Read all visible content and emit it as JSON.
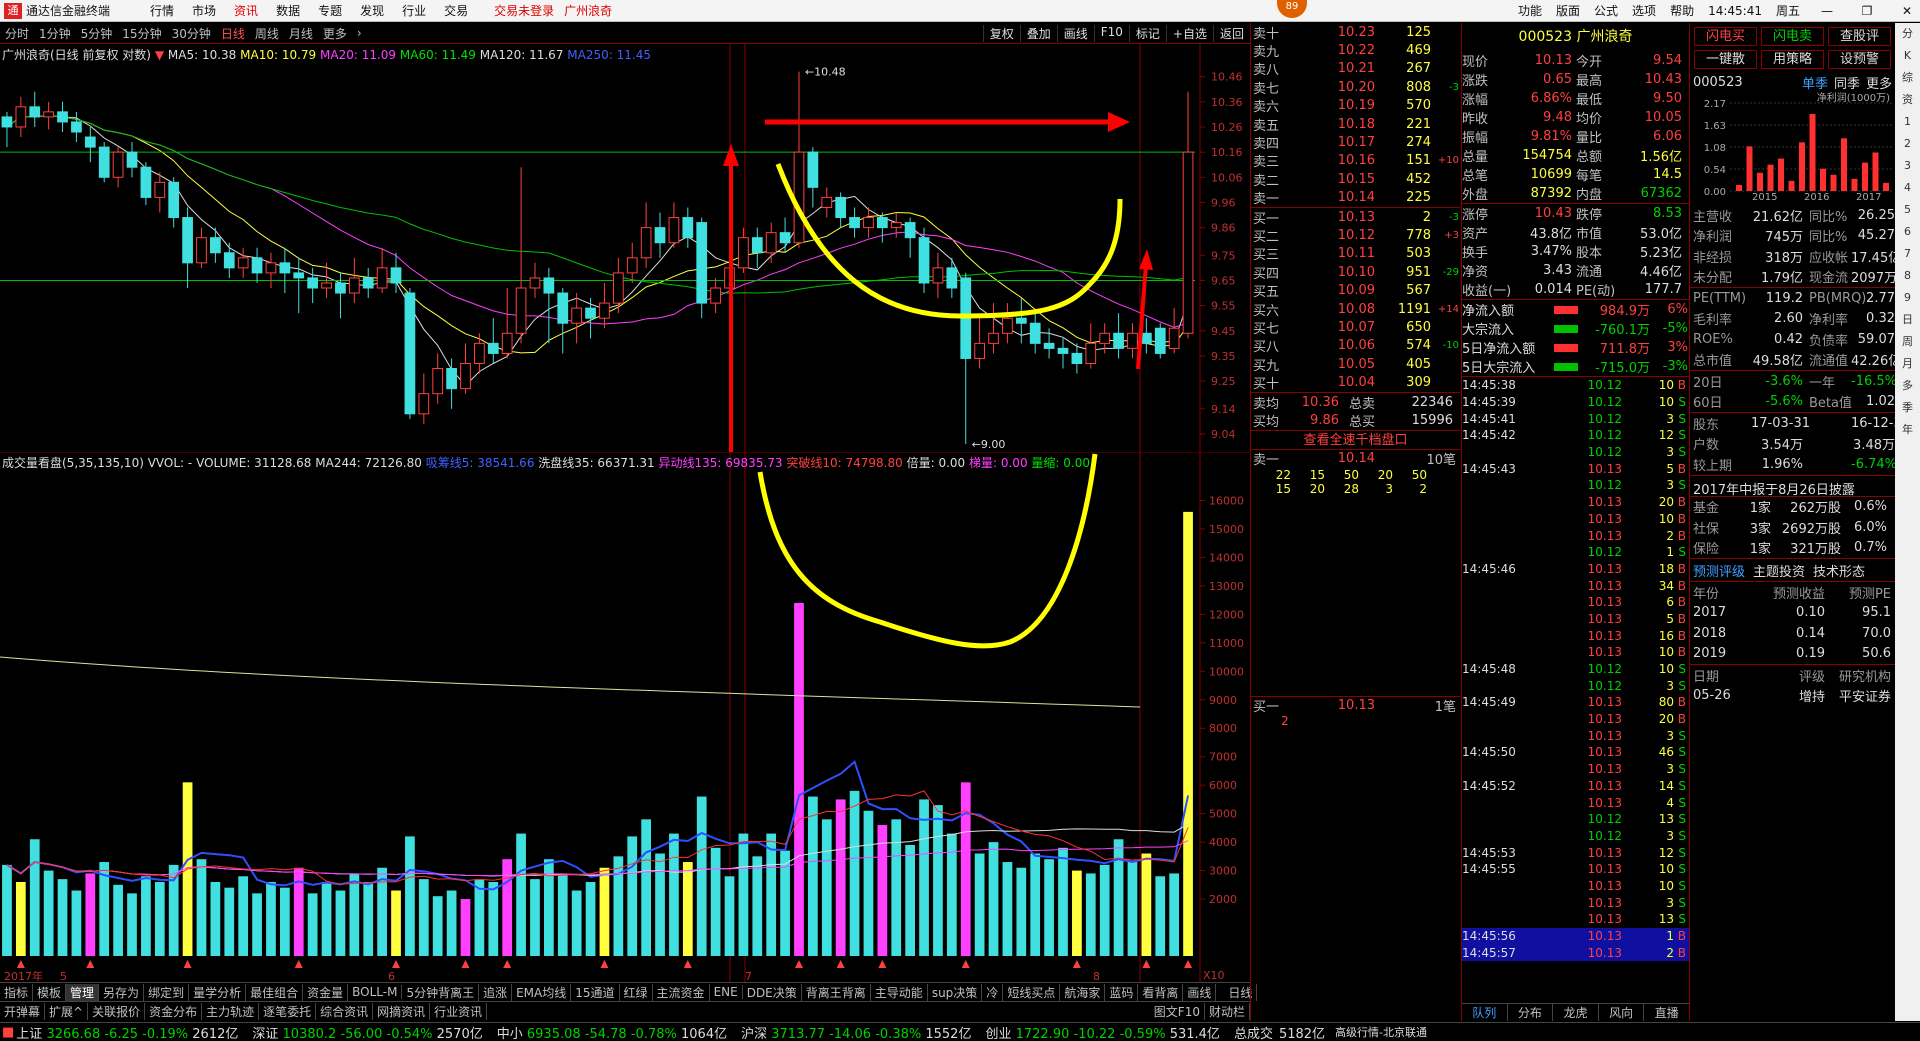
{
  "titlebar": {
    "app": "通达信金融终端",
    "menu": [
      "行情",
      "市场",
      "资讯",
      "数据",
      "专题",
      "发现",
      "行业",
      "交易"
    ],
    "active": "资讯",
    "warn": "交易未登录",
    "stock": "广州浪奇",
    "right": [
      "功能",
      "版面",
      "公式",
      "选项",
      "帮助"
    ],
    "clock": "14:45:41",
    "weekday": "周五",
    "badge": "89"
  },
  "periods": [
    "分时",
    "1分钟",
    "5分钟",
    "15分钟",
    "30分钟",
    "日线",
    "周线",
    "月线",
    "更多"
  ],
  "active_period": "日线",
  "tools": [
    "复权",
    "叠加",
    "画线",
    "F10",
    "标记",
    "+自选",
    "返回"
  ],
  "legend": {
    "name": "广州浪奇(日线 前复权 对数)",
    "ma5": "MA5: 10.38",
    "ma10": "MA10: 10.79",
    "ma20": "MA20: 11.09",
    "ma60": "MA60: 11.49",
    "ma120": "MA120: 11.67",
    "ma250": "MA250: 11.45"
  },
  "vol_legend": {
    "name": "成交量看盘(5,35,135,10)",
    "vvol": "VVOL: -",
    "volume": "VOLUME: 31128.68",
    "ma244": "MA244: 72126.80",
    "l1": "吸筹线5: 38541.66",
    "l2": "洗盘线35: 66371.31",
    "l3": "异动线135: 69835.73",
    "l4": "突破线10: 74798.80",
    "l5": "倍量: 0.00",
    "l6": "梯量: 0.00",
    "l7": "量缩: 0.00"
  },
  "chart_data": {
    "type": "candlestick",
    "price_axis": [
      10.46,
      10.36,
      10.26,
      10.16,
      10.06,
      9.96,
      9.86,
      9.75,
      9.65,
      9.55,
      9.45,
      9.35,
      9.25,
      9.14,
      9.04
    ],
    "ylim": [
      9.0,
      10.55
    ],
    "high_label": "10.48",
    "low_label": "9.00",
    "month_labels": [
      "2017年",
      "5",
      "6",
      "7",
      "8"
    ],
    "vol_axis": [
      16000,
      15000,
      14000,
      13000,
      12000,
      11000,
      10000,
      9000,
      8000,
      7000,
      6000,
      5000,
      4000,
      3000,
      2000
    ],
    "vol_ylim": [
      0,
      17000
    ],
    "candles": [
      [
        10.3,
        10.26,
        10.32,
        10.18
      ],
      [
        10.26,
        10.34,
        10.38,
        10.22
      ],
      [
        10.34,
        10.3,
        10.4,
        10.26
      ],
      [
        10.3,
        10.32,
        10.36,
        10.25
      ],
      [
        10.32,
        10.28,
        10.36,
        10.24
      ],
      [
        10.28,
        10.24,
        10.32,
        10.2
      ],
      [
        10.22,
        10.18,
        10.26,
        10.12
      ],
      [
        10.18,
        10.06,
        10.2,
        10.04
      ],
      [
        10.06,
        10.16,
        10.18,
        10.02
      ],
      [
        10.16,
        10.1,
        10.2,
        10.06
      ],
      [
        10.1,
        9.98,
        10.12,
        9.95
      ],
      [
        9.98,
        10.04,
        10.08,
        9.92
      ],
      [
        10.04,
        9.9,
        10.06,
        9.86
      ],
      [
        9.9,
        9.72,
        9.94,
        9.62
      ],
      [
        9.72,
        9.82,
        9.86,
        9.7
      ],
      [
        9.82,
        9.76,
        9.86,
        9.72
      ],
      [
        9.76,
        9.7,
        9.8,
        9.66
      ],
      [
        9.7,
        9.74,
        9.78,
        9.66
      ],
      [
        9.74,
        9.68,
        9.78,
        9.64
      ],
      [
        9.68,
        9.72,
        9.76,
        9.62
      ],
      [
        9.72,
        9.68,
        9.78,
        9.6
      ],
      [
        9.68,
        9.66,
        9.74,
        9.52
      ],
      [
        9.66,
        9.62,
        9.7,
        9.56
      ],
      [
        9.62,
        9.64,
        9.72,
        9.58
      ],
      [
        9.64,
        9.6,
        9.68,
        9.5
      ],
      [
        9.6,
        9.66,
        9.74,
        9.56
      ],
      [
        9.66,
        9.62,
        9.7,
        9.58
      ],
      [
        9.62,
        9.7,
        9.78,
        9.6
      ],
      [
        9.7,
        9.64,
        9.76,
        9.6
      ],
      [
        9.6,
        9.12,
        9.62,
        9.1
      ],
      [
        9.12,
        9.2,
        9.28,
        9.08
      ],
      [
        9.2,
        9.3,
        9.36,
        9.16
      ],
      [
        9.3,
        9.22,
        9.34,
        9.14
      ],
      [
        9.22,
        9.32,
        9.4,
        9.2
      ],
      [
        9.32,
        9.4,
        9.44,
        9.28
      ],
      [
        9.4,
        9.36,
        9.5,
        9.32
      ],
      [
        9.36,
        9.44,
        9.62,
        9.34
      ],
      [
        9.44,
        9.62,
        10.1,
        9.4
      ],
      [
        9.62,
        9.66,
        9.72,
        9.58
      ],
      [
        9.66,
        9.6,
        9.7,
        9.4
      ],
      [
        9.6,
        9.48,
        9.62,
        9.36
      ],
      [
        9.48,
        9.54,
        9.6,
        9.4
      ],
      [
        9.54,
        9.5,
        9.58,
        9.42
      ],
      [
        9.5,
        9.56,
        9.64,
        9.46
      ],
      [
        9.56,
        9.68,
        9.74,
        9.52
      ],
      [
        9.68,
        9.74,
        9.8,
        9.64
      ],
      [
        9.74,
        9.86,
        9.96,
        9.7
      ],
      [
        9.86,
        9.8,
        9.92,
        9.74
      ],
      [
        9.8,
        9.9,
        9.96,
        9.78
      ],
      [
        9.9,
        9.82,
        9.94,
        9.78
      ],
      [
        9.88,
        9.56,
        9.9,
        9.5
      ],
      [
        9.56,
        9.62,
        9.66,
        9.52
      ],
      [
        9.62,
        9.7,
        9.8,
        9.58
      ],
      [
        9.7,
        9.82,
        9.86,
        9.68
      ],
      [
        9.82,
        9.76,
        9.86,
        9.7
      ],
      [
        9.76,
        9.84,
        9.88,
        9.72
      ],
      [
        9.84,
        9.8,
        9.9,
        9.76
      ],
      [
        9.8,
        10.16,
        10.48,
        9.78
      ],
      [
        10.16,
        10.02,
        10.18,
        9.94
      ],
      [
        9.94,
        9.98,
        10.02,
        9.9
      ],
      [
        9.98,
        9.9,
        10.0,
        9.86
      ],
      [
        9.9,
        9.86,
        9.94,
        9.82
      ],
      [
        9.86,
        9.9,
        9.94,
        9.82
      ],
      [
        9.9,
        9.86,
        9.92,
        9.8
      ],
      [
        9.86,
        9.88,
        9.92,
        9.82
      ],
      [
        9.88,
        9.82,
        9.9,
        9.74
      ],
      [
        9.82,
        9.64,
        9.86,
        9.6
      ],
      [
        9.64,
        9.7,
        9.76,
        9.58
      ],
      [
        9.7,
        9.62,
        9.74,
        9.58
      ],
      [
        9.66,
        9.34,
        9.68,
        9.0
      ],
      [
        9.34,
        9.4,
        9.5,
        9.3
      ],
      [
        9.4,
        9.44,
        9.56,
        9.36
      ],
      [
        9.44,
        9.5,
        9.56,
        9.4
      ],
      [
        9.5,
        9.48,
        9.58,
        9.4
      ],
      [
        9.48,
        9.4,
        9.52,
        9.36
      ],
      [
        9.4,
        9.38,
        9.46,
        9.34
      ],
      [
        9.38,
        9.36,
        9.42,
        9.3
      ],
      [
        9.36,
        9.32,
        9.4,
        9.28
      ],
      [
        9.32,
        9.4,
        9.48,
        9.3
      ],
      [
        9.4,
        9.44,
        9.48,
        9.36
      ],
      [
        9.44,
        9.38,
        9.52,
        9.34
      ],
      [
        9.38,
        9.44,
        9.48,
        9.34
      ],
      [
        9.44,
        9.4,
        9.5,
        9.36
      ],
      [
        9.46,
        9.36,
        9.48,
        9.34
      ],
      [
        9.38,
        9.46,
        9.54,
        9.36
      ],
      [
        9.44,
        10.16,
        10.4,
        9.42
      ]
    ],
    "volumes": [
      3200,
      2600,
      4100,
      3000,
      2700,
      2300,
      2900,
      3300,
      2500,
      2200,
      2800,
      2600,
      3200,
      6100,
      3400,
      2600,
      2400,
      2800,
      2200,
      2600,
      2400,
      3100,
      2200,
      2600,
      2300,
      2900,
      2600,
      3100,
      2300,
      4200,
      2700,
      2100,
      2300,
      2000,
      2700,
      2600,
      3400,
      4300,
      2700,
      3400,
      2900,
      2300,
      2600,
      3100,
      3500,
      4200,
      4800,
      3600,
      4300,
      3300,
      5600,
      3800,
      2800,
      4300,
      3500,
      4300,
      3700,
      12400,
      5600,
      4800,
      5500,
      5800,
      5100,
      4600,
      4800,
      3900,
      5500,
      5300,
      4300,
      6100,
      3600,
      4000,
      3300,
      3100,
      3600,
      3400,
      3800,
      3000,
      2900,
      3200,
      4100,
      3300,
      3600,
      2800,
      2900,
      15600
    ]
  },
  "orderbook": {
    "asks": [
      [
        "卖十",
        "10.23",
        "125",
        ""
      ],
      [
        "卖九",
        "10.22",
        "469",
        ""
      ],
      [
        "卖八",
        "10.21",
        "267",
        ""
      ],
      [
        "卖七",
        "10.20",
        "808",
        "-3"
      ],
      [
        "卖六",
        "10.19",
        "570",
        ""
      ],
      [
        "卖五",
        "10.18",
        "221",
        ""
      ],
      [
        "卖四",
        "10.17",
        "274",
        ""
      ],
      [
        "卖三",
        "10.16",
        "151",
        "+10"
      ],
      [
        "卖二",
        "10.15",
        "452",
        ""
      ],
      [
        "卖一",
        "10.14",
        "225",
        ""
      ]
    ],
    "bids": [
      [
        "买一",
        "10.13",
        "2",
        "-3"
      ],
      [
        "买二",
        "10.12",
        "778",
        "+3"
      ],
      [
        "买三",
        "10.11",
        "503",
        ""
      ],
      [
        "买四",
        "10.10",
        "951",
        "-29"
      ],
      [
        "买五",
        "10.09",
        "567",
        ""
      ],
      [
        "买六",
        "10.08",
        "1191",
        "+14"
      ],
      [
        "买七",
        "10.07",
        "650",
        ""
      ],
      [
        "买八",
        "10.06",
        "574",
        "-10"
      ],
      [
        "买九",
        "10.05",
        "405",
        ""
      ],
      [
        "买十",
        "10.04",
        "309",
        ""
      ]
    ],
    "avg": [
      [
        "卖均",
        "10.36",
        "总卖",
        "22346"
      ],
      [
        "买均",
        "9.86",
        "总买",
        "15996"
      ]
    ],
    "link": "查看全速千档盘口",
    "sell1": {
      "label": "卖一",
      "price": "10.14",
      "count": "10笔",
      "qty": [
        "22",
        "15",
        "50",
        "20",
        "50",
        "15",
        "20",
        "28",
        "3",
        "2"
      ]
    },
    "buy1": {
      "label": "买一",
      "price": "10.13",
      "count": "1笔",
      "qty": "2"
    }
  },
  "quote": {
    "code": "000523",
    "name": "广州浪奇",
    "rows": [
      [
        "现价",
        "10.13",
        "今开",
        "9.54"
      ],
      [
        "涨跌",
        "0.65",
        "最高",
        "10.43"
      ],
      [
        "涨幅",
        "6.86%",
        "最低",
        "9.50"
      ],
      [
        "昨收",
        "9.48",
        "均价",
        "10.05"
      ],
      [
        "振幅",
        "9.81%",
        "量比",
        "6.06"
      ],
      [
        "总量",
        "154754",
        "总额",
        "1.56亿"
      ],
      [
        "总笔",
        "10699",
        "每笔",
        "14.5"
      ],
      [
        "外盘",
        "87392",
        "内盘",
        "67362"
      ]
    ],
    "rows2": [
      [
        "涨停",
        "10.43",
        "跌停",
        "8.53"
      ],
      [
        "资产",
        "43.8亿",
        "市值",
        "53.0亿"
      ],
      [
        "换手",
        "3.47%",
        "股本",
        "5.23亿"
      ],
      [
        "净资",
        "3.43",
        "流通",
        "4.46亿"
      ],
      [
        "收益(一)",
        "0.014",
        "PE(动)",
        "177.7"
      ]
    ],
    "flows": [
      [
        "净流入额",
        "984.9万",
        "6%",
        "red"
      ],
      [
        "大宗流入",
        "-760.1万",
        "-5%",
        "green"
      ],
      [
        "5日净流入额",
        "711.8万",
        "3%",
        "red"
      ],
      [
        "5日大宗流入",
        "-715.0万",
        "-3%",
        "green"
      ]
    ],
    "ticks": [
      [
        "14:45:38",
        "10.12",
        "10",
        "B"
      ],
      [
        "14:45:39",
        "10.12",
        "10",
        "S"
      ],
      [
        "14:45:41",
        "10.12",
        "3",
        "S"
      ],
      [
        "14:45:42",
        "10.12",
        "12",
        "S"
      ],
      [
        "",
        "10.12",
        "3",
        "S"
      ],
      [
        "14:45:43",
        "10.13",
        "5",
        "B"
      ],
      [
        "",
        "10.12",
        "3",
        "S"
      ],
      [
        "",
        "10.13",
        "20",
        "B"
      ],
      [
        "",
        "10.13",
        "10",
        "B"
      ],
      [
        "",
        "10.13",
        "2",
        "B"
      ],
      [
        "",
        "10.12",
        "1",
        "S"
      ],
      [
        "14:45:46",
        "10.13",
        "18",
        "B"
      ],
      [
        "",
        "10.13",
        "34",
        "B"
      ],
      [
        "",
        "10.13",
        "6",
        "B"
      ],
      [
        "",
        "10.13",
        "5",
        "B"
      ],
      [
        "",
        "10.13",
        "16",
        "B"
      ],
      [
        "",
        "10.13",
        "10",
        "B"
      ],
      [
        "14:45:48",
        "10.12",
        "10",
        "S"
      ],
      [
        "",
        "10.12",
        "3",
        "S"
      ],
      [
        "14:45:49",
        "10.13",
        "80",
        "B"
      ],
      [
        "",
        "10.13",
        "20",
        "B"
      ],
      [
        "",
        "10.13",
        "3",
        "S"
      ],
      [
        "14:45:50",
        "10.13",
        "46",
        "S"
      ],
      [
        "",
        "10.13",
        "3",
        "S"
      ],
      [
        "14:45:52",
        "10.13",
        "14",
        "S"
      ],
      [
        "",
        "10.13",
        "4",
        "S"
      ],
      [
        "",
        "10.12",
        "13",
        "S"
      ],
      [
        "",
        "10.12",
        "3",
        "S"
      ],
      [
        "14:45:53",
        "10.13",
        "12",
        "S"
      ],
      [
        "14:45:55",
        "10.13",
        "10",
        "S"
      ],
      [
        "",
        "10.13",
        "10",
        "S"
      ],
      [
        "",
        "10.13",
        "3",
        "S"
      ],
      [
        "",
        "10.13",
        "13",
        "S"
      ],
      [
        "14:45:56",
        "10.13",
        "1",
        "B"
      ],
      [
        "14:45:57",
        "10.13",
        "2",
        "B"
      ]
    ],
    "tabs": [
      "队列",
      "分布",
      "龙虎",
      "风向",
      "直播"
    ]
  },
  "f10": {
    "buttons": [
      "闪电买",
      "闪电卖",
      "查股评",
      "一键散",
      "用策略",
      "设预警"
    ],
    "code": "000523",
    "tabs": [
      "单季",
      "同季",
      "更多"
    ],
    "chart_title": "净利润(1000万)",
    "years": [
      "2015",
      "2016",
      "2017"
    ],
    "yticks": [
      "2.17",
      "1.63",
      "1.08",
      "0.54",
      "0.00"
    ],
    "bars": [
      0.15,
      1.1,
      0.45,
      0.65,
      0.8,
      0.25,
      1.2,
      1.9,
      0.55,
      0.4,
      1.3,
      0.3,
      0.7,
      0.95,
      0.2
    ],
    "rows": [
      [
        "主营收",
        "21.62亿",
        "同比%",
        "26.25"
      ],
      [
        "净利润",
        "745万",
        "同比%",
        "45.27"
      ],
      [
        "非经损",
        "318万",
        "应收帐",
        "17.45亿"
      ],
      [
        "未分配",
        "1.79亿",
        "现金流",
        "2097万"
      ]
    ],
    "rows2": [
      [
        "PE(TTM)",
        "119.2",
        "PB(MRQ)",
        "2.77"
      ],
      [
        "毛利率",
        "2.60",
        "净利率",
        "0.32"
      ],
      [
        "ROE%",
        "0.42",
        "负债率",
        "59.07"
      ],
      [
        "总市值",
        "49.58亿",
        "流通值",
        "42.26亿"
      ]
    ],
    "rows3": [
      [
        "20日",
        "-3.6%",
        "一年",
        "-16.5%"
      ],
      [
        "60日",
        "-5.6%",
        "Beta值",
        "1.02"
      ]
    ],
    "rows4": [
      [
        "股东",
        "17-03-31",
        "",
        "16-12-31"
      ],
      [
        "户数",
        "3.54万",
        "",
        "3.48万"
      ],
      [
        "较上期",
        "1.96%",
        "",
        "-6.74%"
      ]
    ],
    "report": "2017年中报于8月26日披露",
    "holders": [
      [
        "基金",
        "1家",
        "262万股",
        "0.6%"
      ],
      [
        "社保",
        "3家",
        "2692万股",
        "6.0%"
      ],
      [
        "保险",
        "1家",
        "321万股",
        "0.7%"
      ]
    ],
    "subtabs": [
      "预测评级",
      "主题投资",
      "技术形态"
    ],
    "fc_head": [
      "年份",
      "预测收益",
      "预测PE"
    ],
    "forecast": [
      [
        "2017",
        "0.10",
        "95.1"
      ],
      [
        "2018",
        "0.14",
        "70.0"
      ],
      [
        "2019",
        "0.19",
        "50.6"
      ]
    ],
    "rating_head": [
      "日期",
      "评级",
      "研究机构"
    ],
    "rating": [
      "05-26",
      "增持",
      "平安证券"
    ]
  },
  "bottom": {
    "row1": [
      "指标",
      "模板",
      "管理",
      "另存为",
      "绑定到",
      "量学分析",
      "最佳组合",
      "资金量",
      "BOLL-M",
      "5分钟背离王",
      "追涨",
      "EMA均线",
      "15通道",
      "红绿",
      "主流资金",
      "ENE",
      "DDE决策",
      "背离王背离",
      "主导动能",
      "sup决策",
      "冷",
      "短线买点",
      "航海家",
      "蓝码",
      "看背离",
      "画线"
    ],
    "row2": [
      "开弹幕",
      "扩展^",
      "关联报价",
      "资金分布",
      "主力轨迹",
      "逐笔委托",
      "综合资讯",
      "网摘资讯",
      "行业资讯"
    ],
    "right1": "日线",
    "right2": [
      "图文F10",
      "财动栏"
    ]
  },
  "status": [
    [
      "上证",
      "3266.68",
      "-6.25",
      "-0.19%",
      "2612亿"
    ],
    [
      "深证",
      "10380.2",
      "-56.00",
      "-0.54%",
      "2570亿"
    ],
    [
      "中小",
      "6935.08",
      "-54.78",
      "-0.78%",
      "1064亿"
    ],
    [
      "沪深",
      "3713.77",
      "-14.06",
      "-0.38%",
      "1552亿"
    ],
    [
      "创业",
      "1722.90",
      "-10.22",
      "-0.59%",
      "531.4亿"
    ]
  ],
  "status_tail": [
    "总成交",
    "5182亿",
    "高级行情-北京联通"
  ],
  "sideicons": [
    "分",
    "K",
    "综",
    "资",
    "1",
    "2",
    "3",
    "4",
    "5",
    "6",
    "7",
    "8",
    "9",
    "日",
    "周",
    "月",
    "多",
    "季",
    "年"
  ]
}
